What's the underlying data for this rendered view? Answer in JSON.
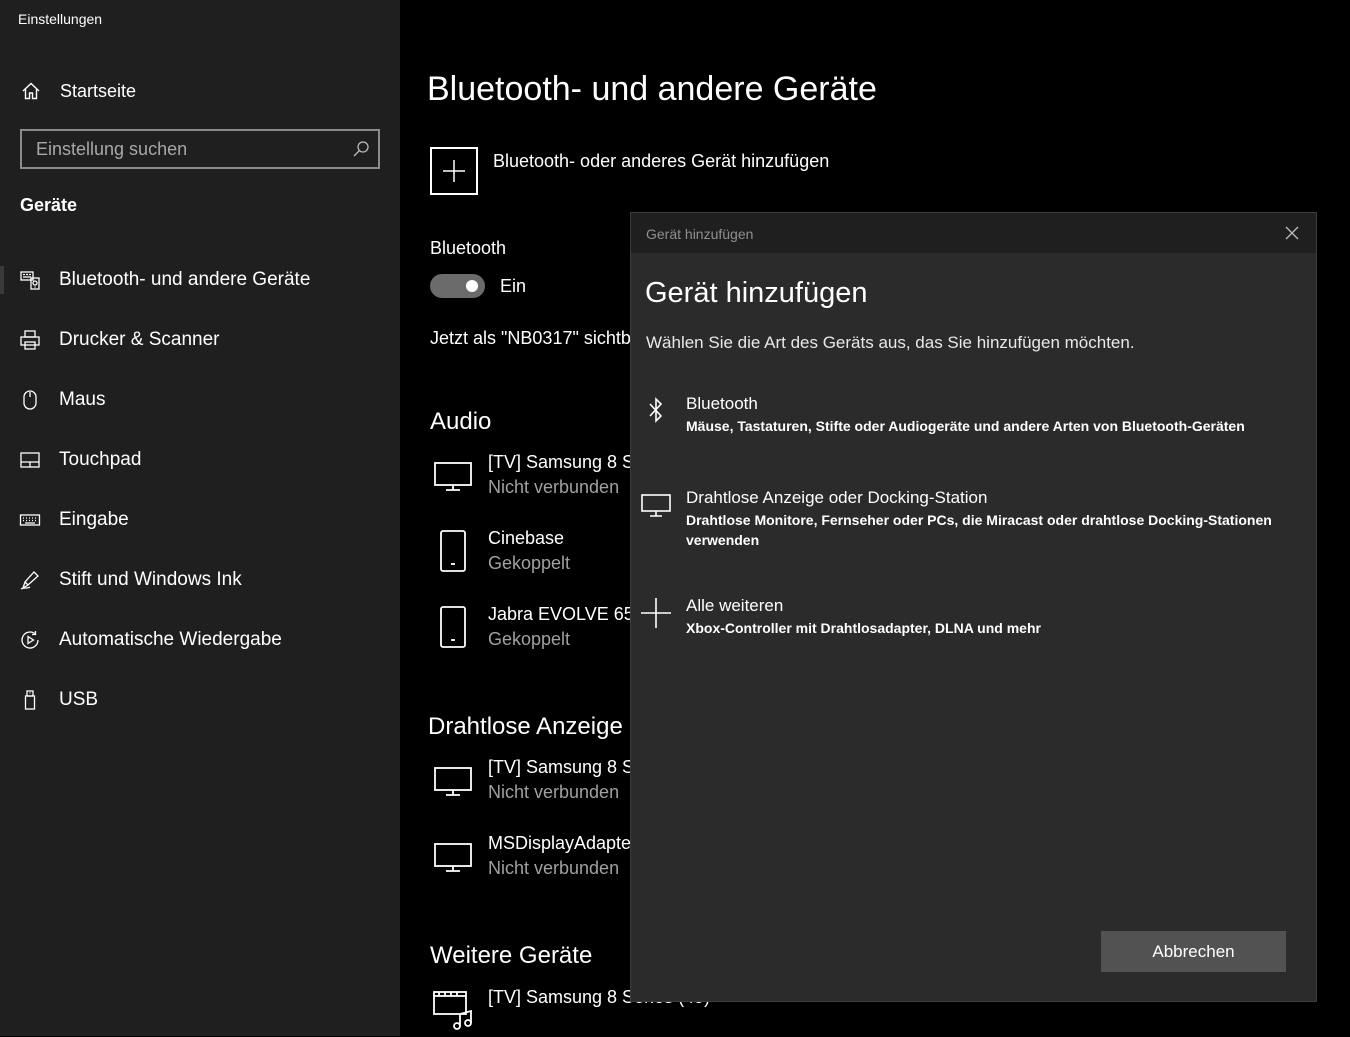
{
  "app": {
    "title": "Einstellungen"
  },
  "sidebar": {
    "home_label": "Startseite",
    "search_placeholder": "Einstellung suchen",
    "section_label": "Geräte",
    "items": [
      {
        "label": "Bluetooth- und andere Geräte",
        "icon": "bluetooth-devices-icon",
        "selected": true
      },
      {
        "label": "Drucker & Scanner",
        "icon": "printer-icon"
      },
      {
        "label": "Maus",
        "icon": "mouse-icon"
      },
      {
        "label": "Touchpad",
        "icon": "touchpad-icon"
      },
      {
        "label": "Eingabe",
        "icon": "keyboard-icon"
      },
      {
        "label": "Stift und Windows Ink",
        "icon": "pen-icon"
      },
      {
        "label": "Automatische Wiedergabe",
        "icon": "autoplay-icon"
      },
      {
        "label": "USB",
        "icon": "usb-icon"
      }
    ]
  },
  "main": {
    "title": "Bluetooth- und andere Geräte",
    "add_device_label": "Bluetooth- oder anderes Gerät hinzufügen",
    "bluetooth_heading": "Bluetooth",
    "bluetooth_state": "Ein",
    "bluetooth_on": true,
    "visible_as": "Jetzt als \"NB0317\" sichtb",
    "groups": {
      "audio": {
        "title": "Audio",
        "devices": [
          {
            "name": "[TV] Samsung 8 S",
            "status": "Nicht verbunden",
            "icon": "monitor-icon"
          },
          {
            "name": "Cinebase",
            "status": "Gekoppelt",
            "icon": "phone-icon"
          },
          {
            "name": "Jabra EVOLVE 65",
            "status": "Gekoppelt",
            "icon": "phone-icon"
          }
        ]
      },
      "wireless": {
        "title": "Drahtlose Anzeige",
        "devices": [
          {
            "name": "[TV] Samsung 8 S",
            "status": "Nicht verbunden",
            "icon": "monitor-icon"
          },
          {
            "name": "MSDisplayAdapte",
            "status": "Nicht verbunden",
            "icon": "monitor-icon"
          }
        ]
      },
      "other": {
        "title": "Weitere Geräte",
        "devices": [
          {
            "name": "[TV] Samsung 8 Series (49)",
            "status": "",
            "icon": "media-device-icon"
          }
        ]
      }
    }
  },
  "dialog": {
    "window_title": "Gerät hinzufügen",
    "heading": "Gerät hinzufügen",
    "subtitle": "Wählen Sie die Art des Geräts aus, das Sie hinzufügen möchten.",
    "options": [
      {
        "title": "Bluetooth",
        "description": "Mäuse, Tastaturen, Stifte oder Audiogeräte und andere Arten von Bluetooth-Geräten",
        "icon": "bluetooth-icon"
      },
      {
        "title": "Drahtlose Anzeige oder Docking-Station",
        "description": "Drahtlose Monitore, Fernseher oder PCs, die Miracast oder drahtlose Docking-Stationen verwenden",
        "icon": "monitor-icon"
      },
      {
        "title": "Alle weiteren",
        "description": "Xbox-Controller mit Drahtlosadapter, DLNA und mehr",
        "icon": "plus-icon"
      }
    ],
    "cancel_label": "Abbrechen"
  }
}
